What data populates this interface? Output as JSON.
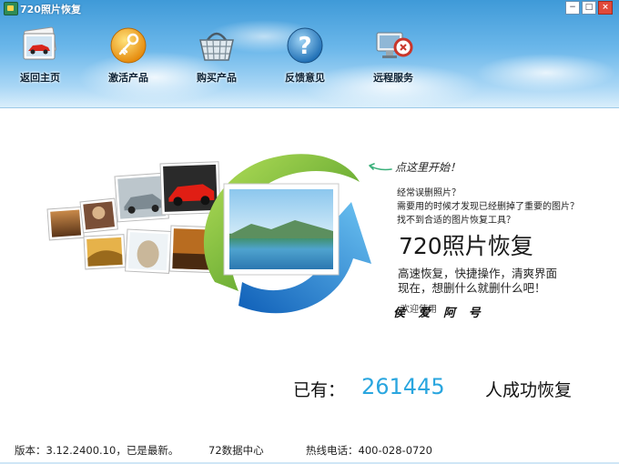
{
  "window": {
    "title": "720照片恢复",
    "minimize_glyph": "−",
    "maximize_glyph": "□",
    "close_glyph": "×"
  },
  "nav": [
    {
      "label": "返回主页",
      "icon": "photo-car-icon"
    },
    {
      "label": "激活产品",
      "icon": "key-icon"
    },
    {
      "label": "购买产品",
      "icon": "basket-icon"
    },
    {
      "label": "反馈意见",
      "icon": "question-icon"
    },
    {
      "label": "远程服务",
      "icon": "remote-service-icon"
    }
  ],
  "hero": {
    "tagline": "点这里开始！",
    "lines": [
      "经常误删照片？",
      "需要用的时候才发现已经删掉了重要的图片？",
      "找不到合适的图片恢复工具？"
    ],
    "product_name": "720照片恢复",
    "slogans": [
      "高速恢复，快捷操作，清爽界面",
      "现在，想删什么就删什么吧！"
    ],
    "welcome": "欢迎使用",
    "handwritten_sign": "侯 爱 阿 号"
  },
  "stats": {
    "prefix": "已有：",
    "count": "261445",
    "suffix": "人成功恢复"
  },
  "footer": {
    "version_label": "版本：",
    "version": "3.12.2400.10",
    "version_status": "，已是最新。",
    "data_center": "72数据中心",
    "hotline_label": "热线电话：",
    "hotline": "400-028-0720"
  },
  "colors": {
    "accent": "#2aa6df",
    "sky_top": "#3f9ad8",
    "arrow_green": "#5fa82a",
    "arrow_blue": "#1e7fd0"
  }
}
